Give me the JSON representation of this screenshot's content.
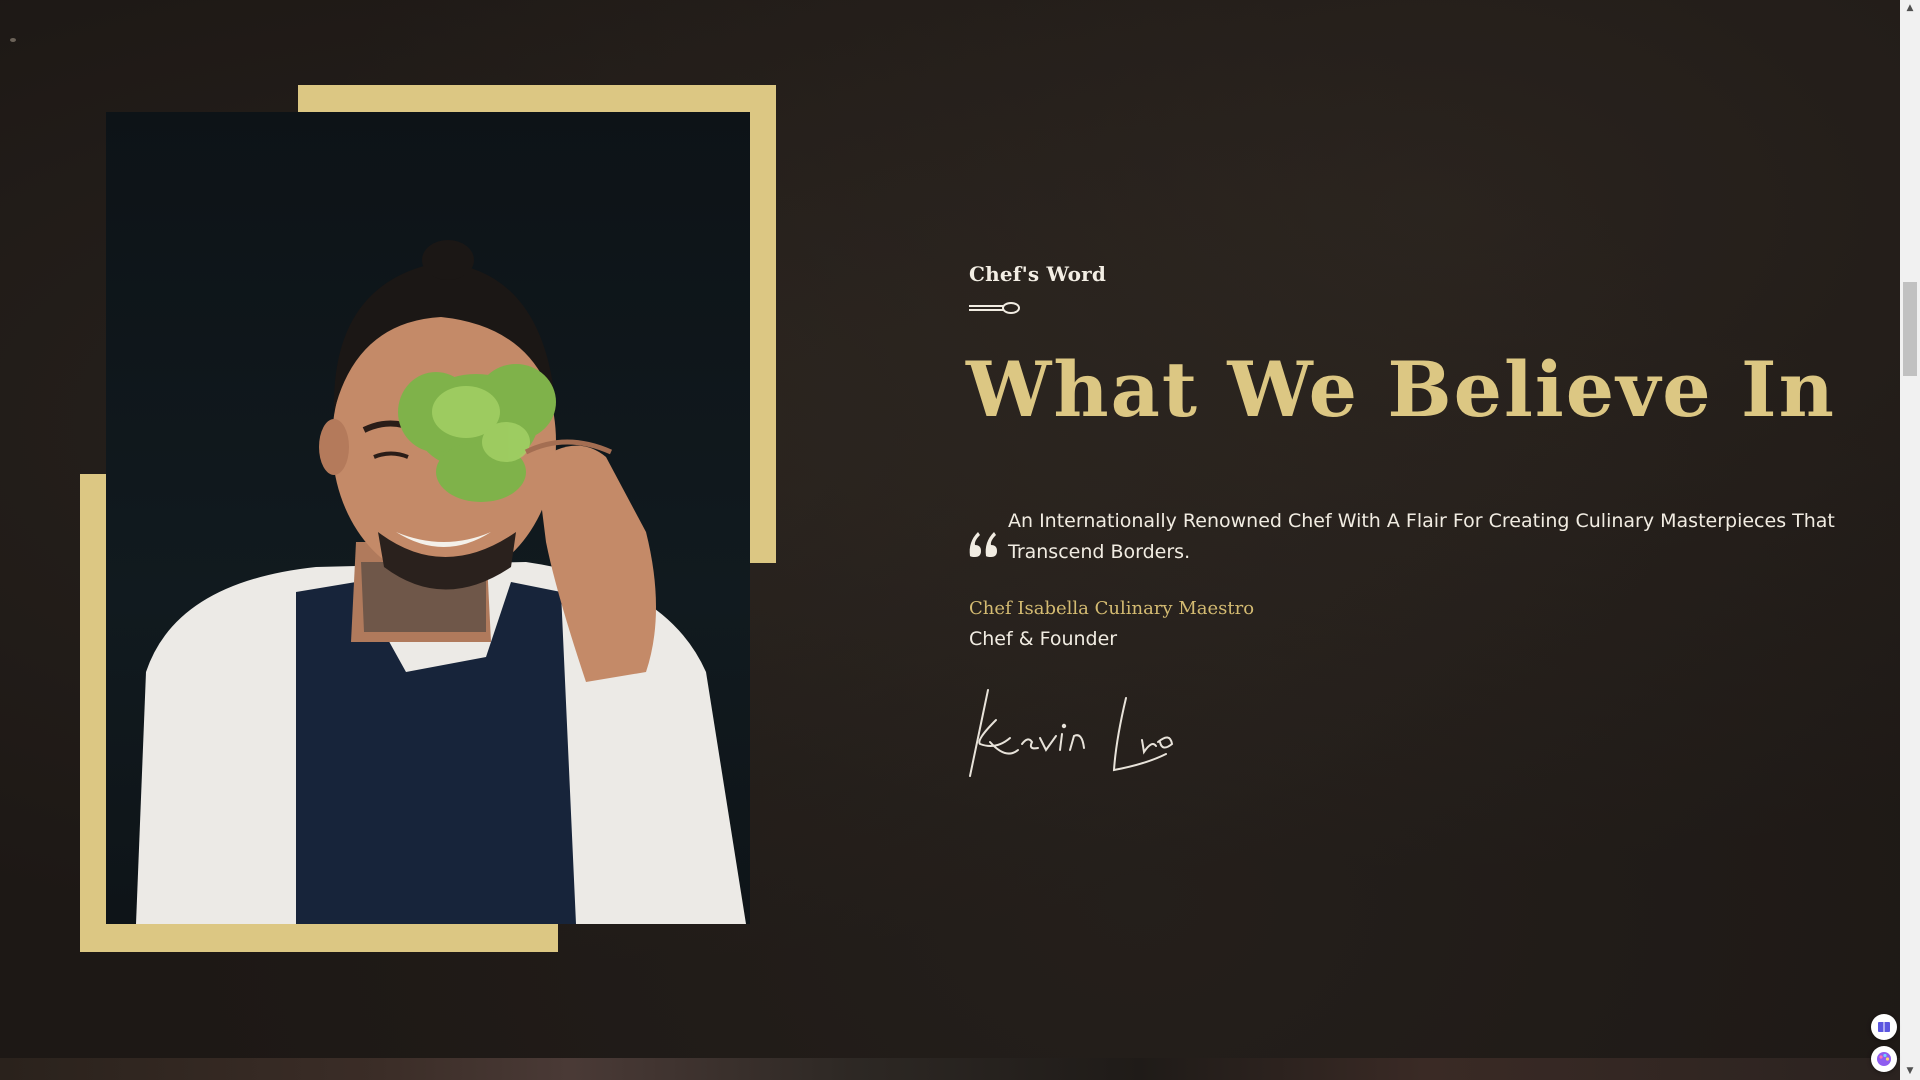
{
  "section": {
    "eyebrow": "Chef's Word",
    "headline": "What We Believe In",
    "quote": "An Internationally Renowned Chef With A Flair For Creating Culinary Masterpieces That Transcend Borders.",
    "author_name": "Chef Isabella Culinary Maestro",
    "author_role": "Chef & Founder",
    "signature": "Kevin Luo"
  },
  "icons": {
    "divider": "spoon-divider-icon",
    "quote": "quote-icon",
    "widget_1": "book-icon",
    "widget_2": "palette-icon",
    "scroll_up": "arrow-up-icon",
    "scroll_down": "arrow-down-icon"
  },
  "colors": {
    "accent_gold": "#dcc783",
    "background": "#1d1815",
    "text": "#f1ece2"
  }
}
